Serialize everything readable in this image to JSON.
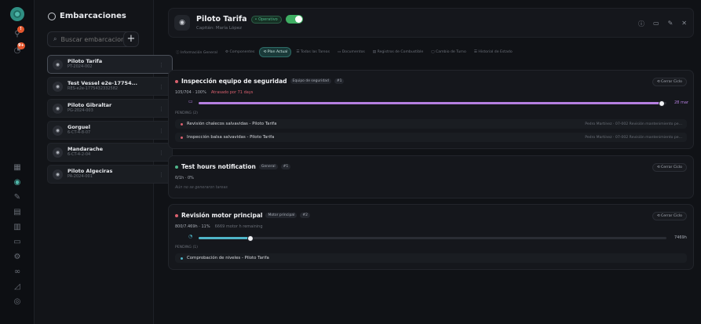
{
  "rail": {
    "badges": [
      "!",
      "9+"
    ]
  },
  "list": {
    "title": "Embarcaciones",
    "search_placeholder": "Buscar embarcaciones",
    "add_label": "+",
    "vessels": [
      {
        "name": "Piloto Tarifa",
        "code": "PT-2024-002"
      },
      {
        "name": "Test Vessel e2e-17754...",
        "code": "RES-e2e-1775432332582"
      },
      {
        "name": "Piloto Gibraltar",
        "code": "PG-2024-003"
      },
      {
        "name": "Gorguel",
        "code": "6-CT-4-8-07"
      },
      {
        "name": "Mandarache",
        "code": "6-CT-4-2-04"
      },
      {
        "name": "Piloto Algeciras",
        "code": "PA-2024-001"
      }
    ]
  },
  "header": {
    "title": "Piloto Tarifa",
    "status": "• Operativo",
    "subtitle": "Capitán: María López"
  },
  "tabs": [
    "ⓘ Información General",
    "⚙ Componentes",
    "⟲ Plan Actual",
    "☰ Todas las Tareas",
    "▭ Documentos",
    "▤ Registros de Combustible",
    "▢ Cambio de Turno",
    "☰ Historial de Estado"
  ],
  "cards": [
    {
      "title": "Inspección equipo de seguridad",
      "chip": "Equipo de seguridad",
      "num": "#1",
      "progress": "105/704 · 100%",
      "late": "Atrasado por 71 days",
      "fill_fraction": 0.99,
      "end_label": "28 mar",
      "pending_label": "PENDING (2)",
      "tasks": [
        {
          "name": "Revisión chalecos salvavidas - Piloto Tarifa",
          "right": "Pedro Martínez · 07-002 Revisión mantenimiento pe..."
        },
        {
          "name": "Inspección balsa salvavidas - Piloto Tarifa",
          "right": "Pedro Martínez · 07-002 Revisión mantenimiento pe..."
        }
      ],
      "button": "⟲ Cerrar Ciclo"
    },
    {
      "title": "Test hours notification",
      "chip": "General",
      "num": "#1",
      "progress": "0/1h · 0%",
      "empty": "Aún no se generaron tareas",
      "button": "⟲ Cerrar Ciclo"
    },
    {
      "title": "Revisión motor principal",
      "chip": "Motor principal",
      "num": "#2",
      "progress": "800/7.469h · 11%",
      "remaining": "6669 motor h remaining",
      "fill_fraction": 0.11,
      "end_label": "7469h",
      "pending_label": "PENDING (1)",
      "tasks": [
        {
          "name": "Comprobación de niveles - Piloto Tarifa",
          "right": ""
        }
      ],
      "button": "⟲ Cerrar Ciclo"
    }
  ],
  "colors": {
    "accent": "#4fb5a8",
    "late": "#d9606e",
    "bar_purple": "#b57fe0",
    "bar_teal": "#4fb5c8"
  }
}
